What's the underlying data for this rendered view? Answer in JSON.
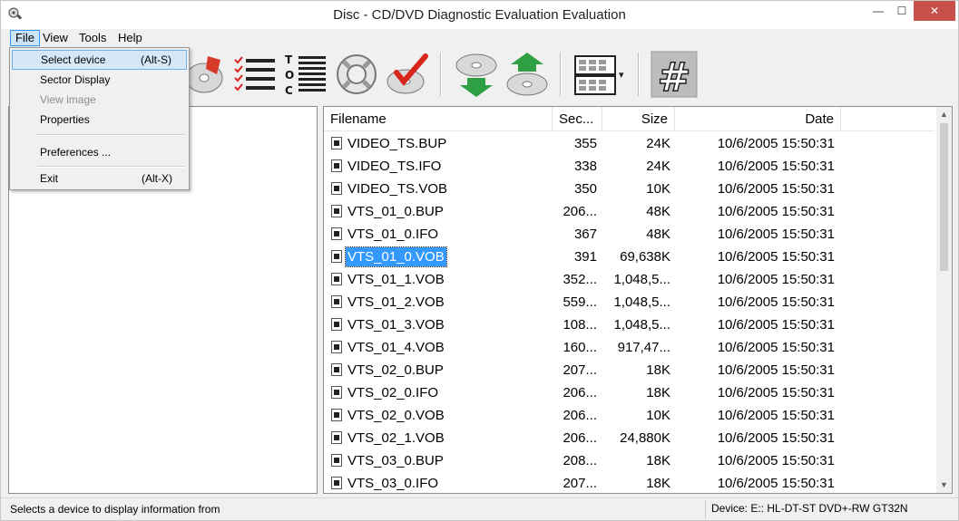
{
  "window": {
    "title": "Disc - CD/DVD Diagnostic Evaluation Evaluation",
    "controls": {
      "minimize": "—",
      "maximize": "☐",
      "close": "✕"
    }
  },
  "menubar": [
    {
      "label": "File"
    },
    {
      "label": "View"
    },
    {
      "label": "Tools"
    },
    {
      "label": "Help"
    }
  ],
  "file_menu": {
    "select_device": {
      "label": "Select device",
      "shortcut": "(Alt-S)"
    },
    "sector_display": {
      "label": "Sector Display"
    },
    "view_image": {
      "label": "View image"
    },
    "properties": {
      "label": "Properties"
    },
    "preferences": {
      "label": "Preferences ..."
    },
    "exit": {
      "label": "Exit",
      "shortcut": "(Alt-X)"
    }
  },
  "toolbar": {
    "icons": [
      "select-disc-icon",
      "checklist-icon",
      "toc-icon",
      "lifebuoy-icon",
      "check-disc-icon",
      "copy-down-icon",
      "copy-up-icon",
      "grid-view-icon",
      "hash-icon"
    ],
    "toc_letters": [
      "T",
      "O",
      "C"
    ],
    "hash_glyph": "#",
    "dropdown_arrow": "▾"
  },
  "file_list": {
    "columns": {
      "filename": "Filename",
      "sector": "Sec...",
      "size": "Size",
      "date": "Date"
    },
    "rows": [
      {
        "name": "VIDEO_TS.BUP",
        "sector": "355",
        "size": "24K",
        "date": "10/6/2005 15:50:31"
      },
      {
        "name": "VIDEO_TS.IFO",
        "sector": "338",
        "size": "24K",
        "date": "10/6/2005 15:50:31"
      },
      {
        "name": "VIDEO_TS.VOB",
        "sector": "350",
        "size": "10K",
        "date": "10/6/2005 15:50:31"
      },
      {
        "name": "VTS_01_0.BUP",
        "sector": "206...",
        "size": "48K",
        "date": "10/6/2005 15:50:31"
      },
      {
        "name": "VTS_01_0.IFO",
        "sector": "367",
        "size": "48K",
        "date": "10/6/2005 15:50:31"
      },
      {
        "name": "VTS_01_0.VOB",
        "sector": "391",
        "size": "69,638K",
        "date": "10/6/2005 15:50:31",
        "selected": true
      },
      {
        "name": "VTS_01_1.VOB",
        "sector": "352...",
        "size": "1,048,5...",
        "date": "10/6/2005 15:50:31"
      },
      {
        "name": "VTS_01_2.VOB",
        "sector": "559...",
        "size": "1,048,5...",
        "date": "10/6/2005 15:50:31"
      },
      {
        "name": "VTS_01_3.VOB",
        "sector": "108...",
        "size": "1,048,5...",
        "date": "10/6/2005 15:50:31"
      },
      {
        "name": "VTS_01_4.VOB",
        "sector": "160...",
        "size": "917,47...",
        "date": "10/6/2005 15:50:31"
      },
      {
        "name": "VTS_02_0.BUP",
        "sector": "207...",
        "size": "18K",
        "date": "10/6/2005 15:50:31"
      },
      {
        "name": "VTS_02_0.IFO",
        "sector": "206...",
        "size": "18K",
        "date": "10/6/2005 15:50:31"
      },
      {
        "name": "VTS_02_0.VOB",
        "sector": "206...",
        "size": "10K",
        "date": "10/6/2005 15:50:31"
      },
      {
        "name": "VTS_02_1.VOB",
        "sector": "206...",
        "size": "24,880K",
        "date": "10/6/2005 15:50:31"
      },
      {
        "name": "VTS_03_0.BUP",
        "sector": "208...",
        "size": "18K",
        "date": "10/6/2005 15:50:31"
      },
      {
        "name": "VTS_03_0.IFO",
        "sector": "207...",
        "size": "18K",
        "date": "10/6/2005 15:50:31"
      }
    ]
  },
  "scrollbar": {
    "up": "▲",
    "down": "▼"
  },
  "status": {
    "left": "Selects a device to display information from",
    "right": "Device: E:: HL-DT-ST DVD+-RW GT32N"
  },
  "colors": {
    "selection": "#3399ff",
    "close_button": "#c7504a",
    "menu_hover": "#d5e8f7"
  }
}
